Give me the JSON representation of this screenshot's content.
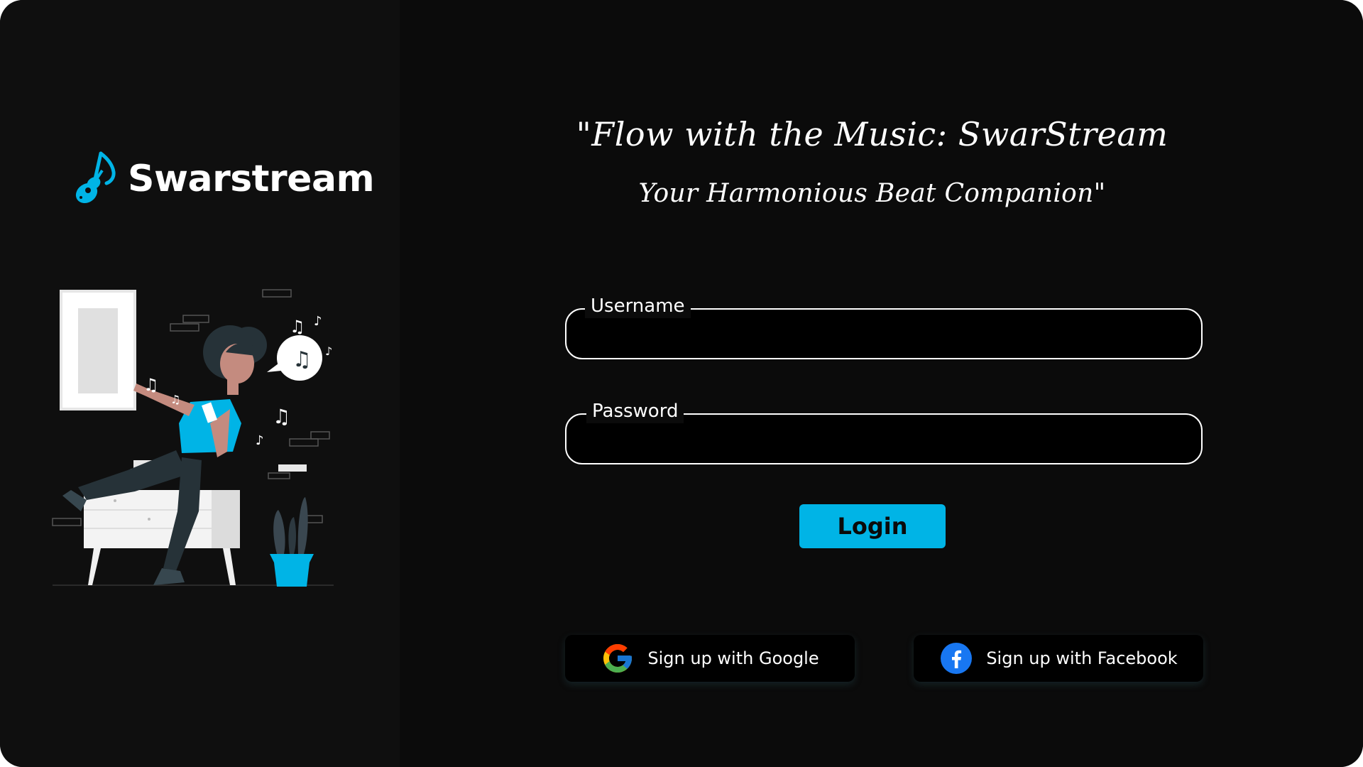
{
  "brand": {
    "name": "Swarstream",
    "accent_color": "#00b4e6",
    "logo_icon": "guitar-music-note-icon"
  },
  "hero": {
    "tagline_line1": "\"Flow with the Music: SwarStream",
    "tagline_line2": "Your Harmonious Beat Companion\"",
    "illustration": "woman-dancing-with-music-illustration"
  },
  "form": {
    "username": {
      "label": "Username",
      "value": ""
    },
    "password": {
      "label": "Password",
      "value": ""
    },
    "login_label": "Login"
  },
  "social": {
    "google_label": "Sign up with Google",
    "google_icon": "google-icon",
    "facebook_label": "Sign up with Facebook",
    "facebook_icon": "facebook-icon",
    "facebook_color": "#1877f2"
  },
  "colors": {
    "background": "#0c0c0c",
    "left_panel": "#0f0f0f",
    "text": "#ffffff"
  }
}
